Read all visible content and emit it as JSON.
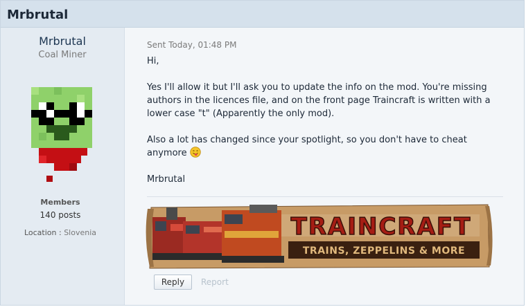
{
  "header": {
    "title": "Mrbrutal"
  },
  "author": {
    "name": "Mrbrutal",
    "title": "Coal Miner",
    "group": "Members",
    "posts": "140 posts",
    "location_label": "Location :",
    "location_value": "Slovenia"
  },
  "message": {
    "sent": "Sent Today, 01:48 PM",
    "greeting": "Hi,",
    "paragraph1": "Yes I'll allow it but I'll ask you to update the info on the mod. You're missing authors in the licences file, and on the front page Traincraft is written with a lower case \"t\" (Apparently the only mod).",
    "paragraph2": "Also a lot has changed since your spotlight, so you don't have to cheat anymore",
    "signoff": "Mrbrutal"
  },
  "banner": {
    "title": "TRAINCRAFT",
    "subtitle": "TRAINS, ZEPPELINS & MORE"
  },
  "actions": {
    "reply_label": "Reply",
    "report_label": "Report"
  },
  "colors": {
    "header_bg": "#d5e1ec",
    "sidebar_bg": "#e4ebf2",
    "content_bg": "#f3f6f9",
    "name_color": "#1d3652",
    "banner_red": "#a51d14",
    "banner_brown": "#3a2010"
  },
  "icons": {
    "avatar": "zombie-creeper-avatar",
    "emoji": "tongue-out-emoji"
  }
}
